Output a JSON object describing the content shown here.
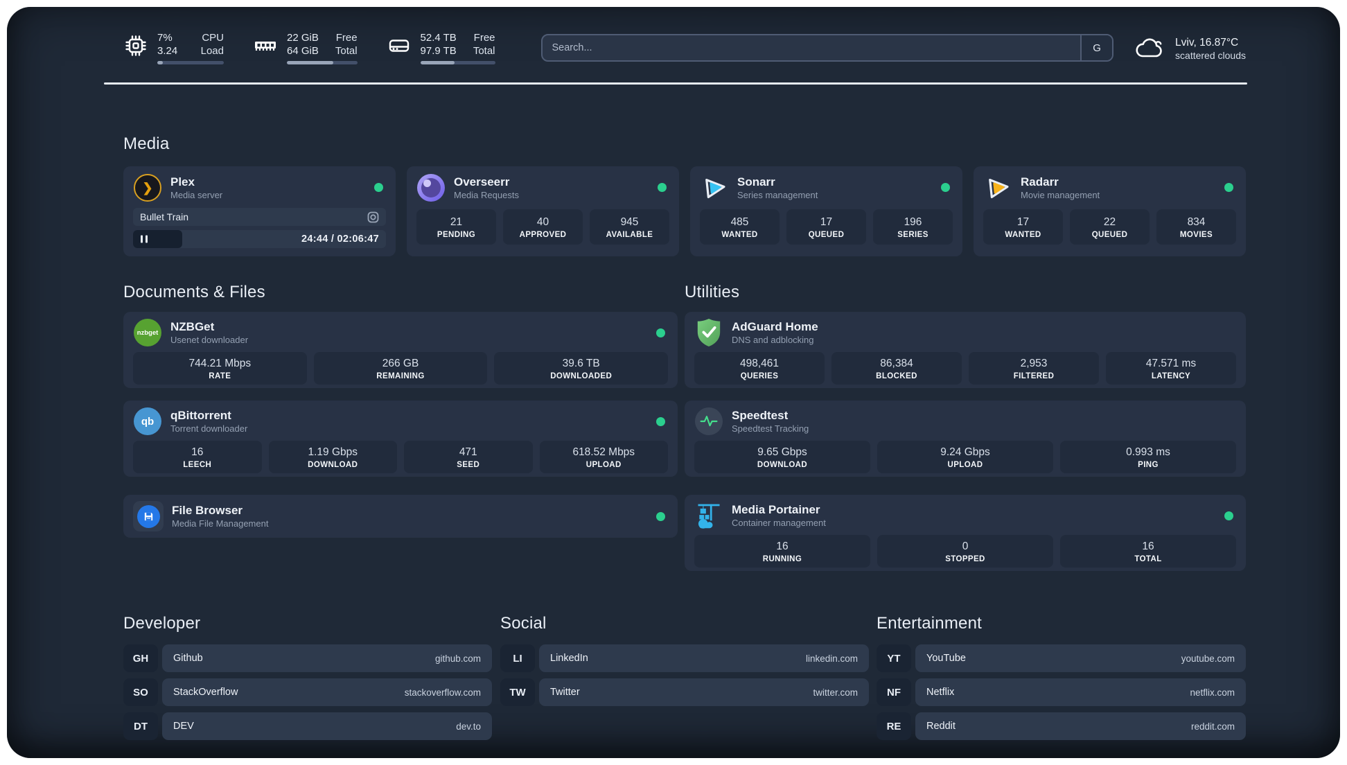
{
  "colors": {
    "status_online": "#2bcf8e",
    "plex_accent": "#e5a00d",
    "background": "#1f2937",
    "card": "#283245"
  },
  "topbar": {
    "stats": [
      {
        "icon": "cpu-icon",
        "values": [
          "7%",
          "3.24"
        ],
        "labels": [
          "CPU",
          "Load"
        ],
        "bar_percent": 8
      },
      {
        "icon": "ram-icon",
        "values": [
          "22 GiB",
          "64 GiB"
        ],
        "labels": [
          "Free",
          "Total"
        ],
        "bar_percent": 66
      },
      {
        "icon": "disk-icon",
        "values": [
          "52.4 TB",
          "97.9 TB"
        ],
        "labels": [
          "Free",
          "Total"
        ],
        "bar_percent": 46
      }
    ],
    "search": {
      "placeholder": "Search...",
      "button_label": "G"
    },
    "weather": {
      "location": "Lviv, 16.87°C",
      "condition": "scattered clouds"
    }
  },
  "media": {
    "title": "Media",
    "plex": {
      "name": "Plex",
      "subtitle": "Media server",
      "now_playing": "Bullet Train",
      "time": "24:44 / 02:06:47",
      "progress_percent": 19.5
    },
    "overseerr": {
      "name": "Overseerr",
      "subtitle": "Media Requests",
      "stats": [
        {
          "value": "21",
          "label": "PENDING"
        },
        {
          "value": "40",
          "label": "APPROVED"
        },
        {
          "value": "945",
          "label": "AVAILABLE"
        }
      ]
    },
    "sonarr": {
      "name": "Sonarr",
      "subtitle": "Series management",
      "stats": [
        {
          "value": "485",
          "label": "WANTED"
        },
        {
          "value": "17",
          "label": "QUEUED"
        },
        {
          "value": "196",
          "label": "SERIES"
        }
      ]
    },
    "radarr": {
      "name": "Radarr",
      "subtitle": "Movie management",
      "stats": [
        {
          "value": "17",
          "label": "WANTED"
        },
        {
          "value": "22",
          "label": "QUEUED"
        },
        {
          "value": "834",
          "label": "MOVIES"
        }
      ]
    }
  },
  "documents": {
    "title": "Documents & Files",
    "nzbget": {
      "name": "NZBGet",
      "subtitle": "Usenet downloader",
      "icon_text": "nzbget",
      "stats": [
        {
          "value": "744.21 Mbps",
          "label": "RATE"
        },
        {
          "value": "266 GB",
          "label": "REMAINING"
        },
        {
          "value": "39.6 TB",
          "label": "DOWNLOADED"
        }
      ]
    },
    "qbittorrent": {
      "name": "qBittorrent",
      "subtitle": "Torrent downloader",
      "icon_text": "qb",
      "stats": [
        {
          "value": "16",
          "label": "LEECH"
        },
        {
          "value": "1.19 Gbps",
          "label": "DOWNLOAD"
        },
        {
          "value": "471",
          "label": "SEED"
        },
        {
          "value": "618.52 Mbps",
          "label": "UPLOAD"
        }
      ]
    },
    "filebrowser": {
      "name": "File Browser",
      "subtitle": "Media File Management"
    }
  },
  "utilities": {
    "title": "Utilities",
    "adguard": {
      "name": "AdGuard Home",
      "subtitle": "DNS and adblocking",
      "stats": [
        {
          "value": "498,461",
          "label": "QUERIES"
        },
        {
          "value": "86,384",
          "label": "BLOCKED"
        },
        {
          "value": "2,953",
          "label": "FILTERED"
        },
        {
          "value": "47.571 ms",
          "label": "LATENCY"
        }
      ]
    },
    "speedtest": {
      "name": "Speedtest",
      "subtitle": "Speedtest Tracking",
      "stats": [
        {
          "value": "9.65 Gbps",
          "label": "DOWNLOAD"
        },
        {
          "value": "9.24 Gbps",
          "label": "UPLOAD"
        },
        {
          "value": "0.993 ms",
          "label": "PING"
        }
      ]
    },
    "portainer": {
      "name": "Media Portainer",
      "subtitle": "Container management",
      "stats": [
        {
          "value": "16",
          "label": "RUNNING"
        },
        {
          "value": "0",
          "label": "STOPPED"
        },
        {
          "value": "16",
          "label": "TOTAL"
        }
      ]
    }
  },
  "links": {
    "developer": {
      "title": "Developer",
      "items": [
        {
          "badge": "GH",
          "name": "Github",
          "url": "github.com"
        },
        {
          "badge": "SO",
          "name": "StackOverflow",
          "url": "stackoverflow.com"
        },
        {
          "badge": "DT",
          "name": "DEV",
          "url": "dev.to"
        }
      ]
    },
    "social": {
      "title": "Social",
      "items": [
        {
          "badge": "LI",
          "name": "LinkedIn",
          "url": "linkedin.com"
        },
        {
          "badge": "TW",
          "name": "Twitter",
          "url": "twitter.com"
        }
      ]
    },
    "entertainment": {
      "title": "Entertainment",
      "items": [
        {
          "badge": "YT",
          "name": "YouTube",
          "url": "youtube.com"
        },
        {
          "badge": "NF",
          "name": "Netflix",
          "url": "netflix.com"
        },
        {
          "badge": "RE",
          "name": "Reddit",
          "url": "reddit.com"
        }
      ]
    }
  }
}
